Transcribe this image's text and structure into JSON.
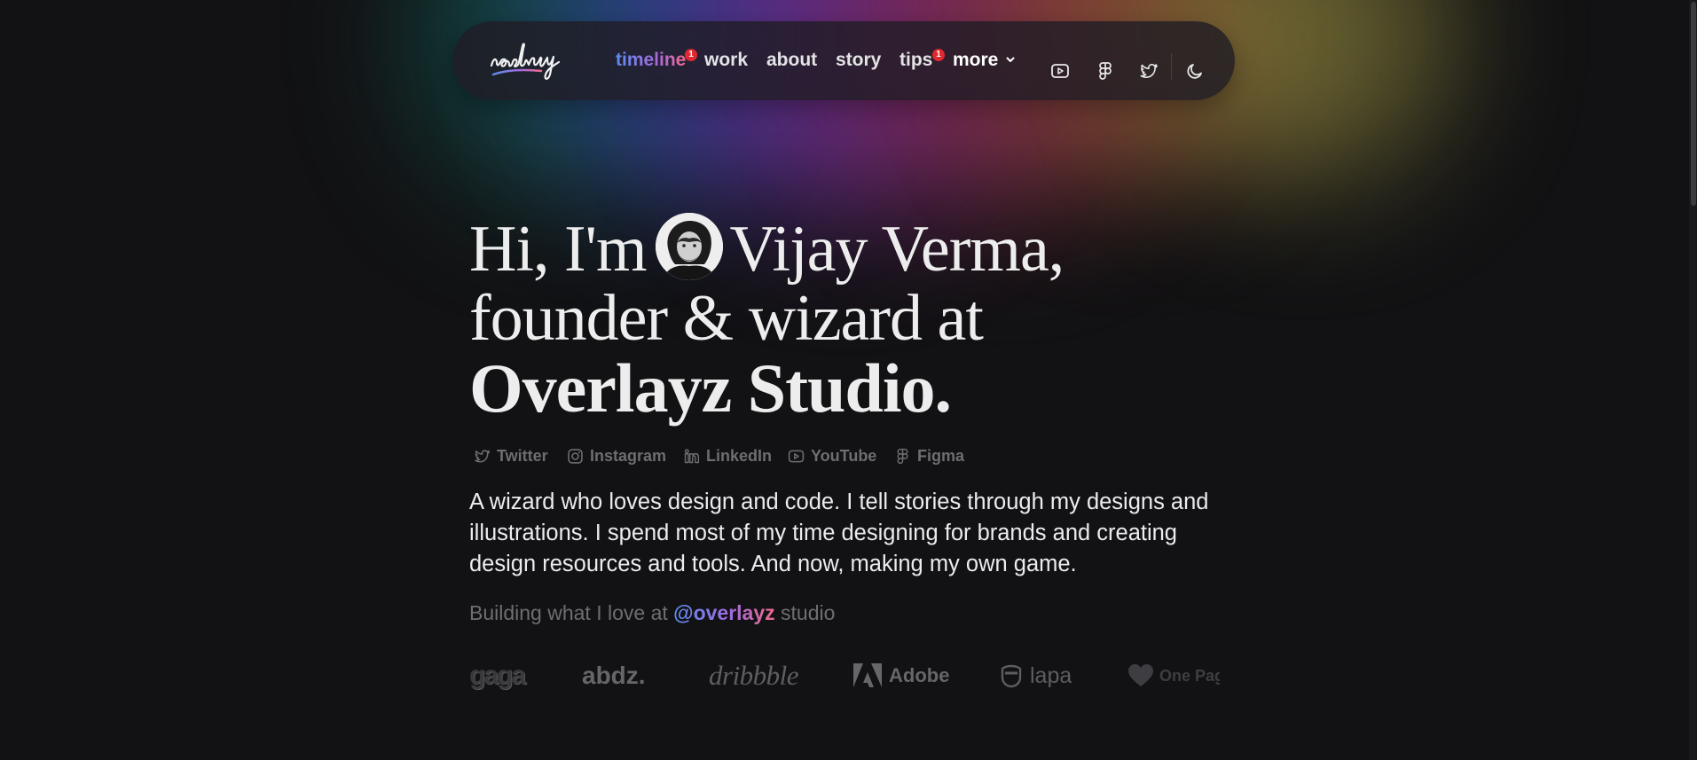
{
  "nav": {
    "logo_text": "realvijy",
    "links": [
      {
        "label": "timeline",
        "badge": "1"
      },
      {
        "label": "work"
      },
      {
        "label": "about"
      },
      {
        "label": "story"
      },
      {
        "label": "tips",
        "badge": "1"
      },
      {
        "label": "more"
      }
    ],
    "icons": [
      "youtube-icon",
      "figma-icon",
      "twitter-icon",
      "moon-icon"
    ]
  },
  "hero": {
    "line1_a": "Hi, I'm",
    "line1_b": "Vijay Verma,",
    "line2": "founder & wizard at",
    "line3": "Overlayz Studio."
  },
  "socials": [
    {
      "label": "Twitter",
      "icon": "twitter-icon"
    },
    {
      "label": "Instagram",
      "icon": "instagram-icon"
    },
    {
      "label": "LinkedIn",
      "icon": "linkedin-icon"
    },
    {
      "label": "YouTube",
      "icon": "youtube-icon"
    },
    {
      "label": "Figma",
      "icon": "figma-icon"
    }
  ],
  "bio": "A wizard who loves design and code. I tell stories through my designs and illustrations. I spend most of my time designing for brands and creating design resources and tools. And now, making my own game.",
  "building": {
    "prefix": "Building what I love at",
    "handle": "@overlayz",
    "suffix": "studio"
  },
  "brands": [
    "gaga",
    "abdz.",
    "dribbble",
    "Adobe",
    "lapa",
    "One Page"
  ],
  "colors": {
    "background": "#121214",
    "accent_start": "#5b8df0",
    "accent_mid": "#a06be0",
    "accent_end": "#f06a8a",
    "badge": "#e0282f"
  }
}
